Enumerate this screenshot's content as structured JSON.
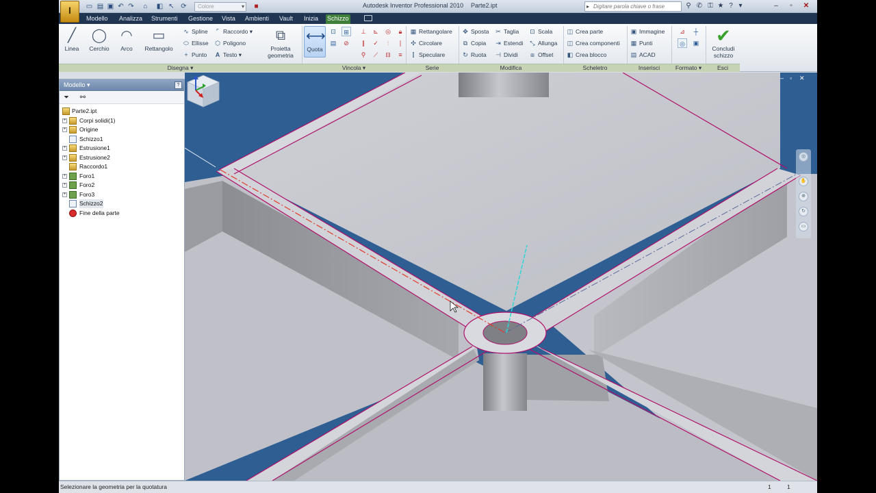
{
  "window": {
    "app_title": "Autodesk Inventor Professional 2010",
    "file_name": "Parte2.ipt",
    "app_button_label": "I",
    "color_combo": "Colore",
    "search_placeholder": "Digitare parola chiave o frase"
  },
  "ribbon_tabs": [
    "Modello",
    "Analizza",
    "Strumenti",
    "Gestione",
    "Vista",
    "Ambienti",
    "Vault",
    "Inizia",
    "Schizzo"
  ],
  "active_tab": "Schizzo",
  "ribbon": {
    "disegna": {
      "panel": "Disegna",
      "linea": "Linea",
      "cerchio": "Cerchio",
      "arco": "Arco",
      "rettangolo": "Rettangolo",
      "spline": "Spline",
      "ellisse": "Ellisse",
      "punto": "Punto",
      "raccordo": "Raccordo",
      "poligono": "Poligono",
      "testo": "Testo",
      "proietta_1": "Proietta",
      "proietta_2": "geometria"
    },
    "vincola": {
      "panel": "Vincola",
      "quota": "Quota"
    },
    "serie": {
      "panel": "Serie",
      "rettangolare": "Rettangolare",
      "circolare": "Circolare",
      "speculare": "Speculare"
    },
    "modifica": {
      "panel": "Modifica",
      "sposta": "Sposta",
      "copia": "Copia",
      "ruota": "Ruota",
      "taglia": "Taglia",
      "estendi": "Estendi",
      "dividi": "Dividi",
      "scala": "Scala",
      "allunga": "Allunga",
      "offset": "Offset"
    },
    "scheletro": {
      "panel": "Scheletro",
      "crea_parte": "Crea parte",
      "crea_componenti": "Crea componenti",
      "crea_blocco": "Crea blocco"
    },
    "inserisci": {
      "panel": "Inserisci",
      "immagine": "Immagine",
      "punti": "Punti",
      "acad": "ACAD"
    },
    "formato": {
      "panel": "Formato"
    },
    "esci": {
      "panel": "Esci",
      "concludi_1": "Concludi",
      "concludi_2": "schizzo"
    }
  },
  "browser": {
    "title": "Modello",
    "tree": [
      {
        "label": "Parte2.ipt",
        "icon": "part-icon",
        "expander": ""
      },
      {
        "label": "Corpi solidi(1)",
        "icon": "solid-bodies-icon",
        "expander": "+"
      },
      {
        "label": "Origine",
        "icon": "origin-folder-icon",
        "expander": "+"
      },
      {
        "label": "Schizzo1",
        "icon": "sketch-icon",
        "expander": ""
      },
      {
        "label": "Estrusione1",
        "icon": "extrusion-icon",
        "expander": "+"
      },
      {
        "label": "Estrusione2",
        "icon": "extrusion-icon",
        "expander": "+"
      },
      {
        "label": "Raccordo1",
        "icon": "fillet-icon",
        "expander": ""
      },
      {
        "label": "Foro1",
        "icon": "hole-icon",
        "expander": "+"
      },
      {
        "label": "Foro2",
        "icon": "hole-icon",
        "expander": "+"
      },
      {
        "label": "Foro3",
        "icon": "hole-icon",
        "expander": "+"
      },
      {
        "label": "Schizzo2",
        "icon": "sketch-icon",
        "expander": ""
      },
      {
        "label": "Fine della parte",
        "icon": "end-of-part-icon",
        "expander": ""
      }
    ]
  },
  "status": {
    "message": "Selezionare la geometria per la quotatura",
    "value_1": "1",
    "value_2": "1"
  },
  "colors": {
    "active_tab": "#3f7f3a",
    "viewport_background": "#2f5e93",
    "sketch_edge": "#b0106a",
    "centerline": "#e33a2a",
    "axis_cyan": "#2fd6d6"
  }
}
